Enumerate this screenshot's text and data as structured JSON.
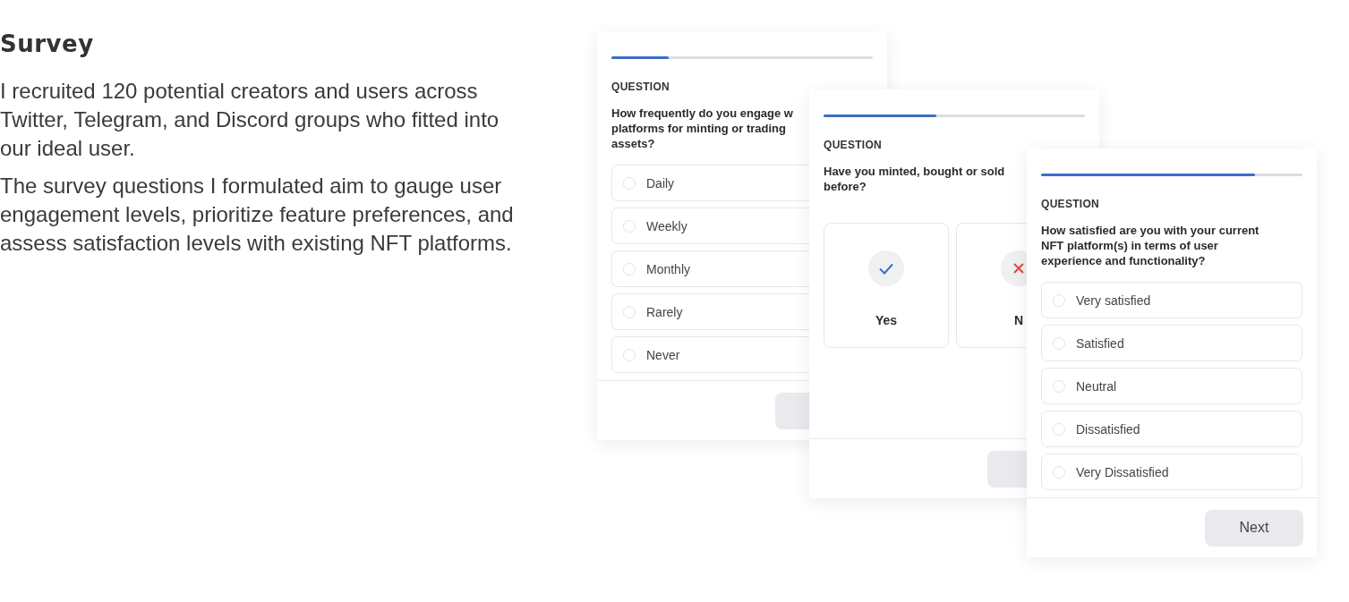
{
  "intro": {
    "title": "Survey",
    "paragraphs": [
      "I recruited 120 potential creators and users across Twitter, Telegram, and Discord groups who fitted into our ideal user.",
      "The survey questions I formulated aim to gauge user engagement levels, prioritize feature preferences, and assess satisfaction levels with existing NFT platforms."
    ]
  },
  "cards": [
    {
      "kind": "options",
      "progress": {
        "level": 0.22
      },
      "label": "QUESTION",
      "question_lines": [
        "How frequently do you engage w",
        "platforms for minting or trading",
        "assets?"
      ],
      "options": [
        {
          "label": "Daily",
          "selected": false
        },
        {
          "label": "Weekly",
          "selected": false
        },
        {
          "label": "Monthly",
          "selected": false
        },
        {
          "label": "Rarely",
          "selected": false
        },
        {
          "label": "Never",
          "selected": false
        }
      ]
    },
    {
      "kind": "choices",
      "progress": {
        "level": 0.43
      },
      "label": "QUESTION",
      "question_lines": [
        "Have you minted, bought or sold",
        "before?"
      ],
      "choices": [
        {
          "kind": "yes",
          "label": "Yes"
        },
        {
          "kind": "no",
          "label": "N"
        }
      ]
    },
    {
      "kind": "options",
      "progress": {
        "level": 0.82
      },
      "label": "QUESTION",
      "question_lines": [
        "How satisfied are you with your current",
        "NFT platform(s) in terms of user",
        "experience and functionality?"
      ],
      "options": [
        {
          "label": "Very satisfied",
          "selected": false
        },
        {
          "label": "Satisfied",
          "selected": false
        },
        {
          "label": "Neutral",
          "selected": false
        },
        {
          "label": "Dissatisfied",
          "selected": false
        },
        {
          "label": "Very Dissatisfied",
          "selected": false
        }
      ],
      "button": "Next"
    }
  ]
}
